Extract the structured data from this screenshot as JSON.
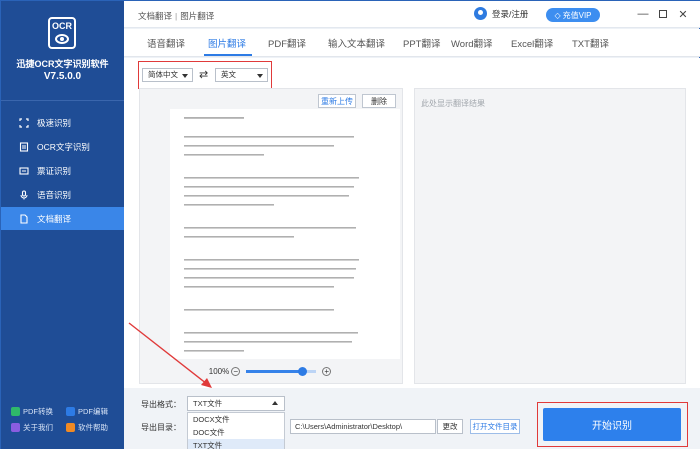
{
  "app": {
    "logo_text": "OCR",
    "name": "迅捷OCR文字识别软件",
    "version": "V7.5.0.0"
  },
  "sidebar": {
    "items": [
      {
        "label": "极速识别",
        "icon": "scan-icon",
        "active": false
      },
      {
        "label": "OCR文字识别",
        "icon": "ocr-icon",
        "active": false
      },
      {
        "label": "票证识别",
        "icon": "ticket-icon",
        "active": false
      },
      {
        "label": "语音识别",
        "icon": "microphone-icon",
        "active": false
      },
      {
        "label": "文档翻译",
        "icon": "document-icon",
        "active": true
      }
    ],
    "bottom_links": [
      {
        "label": "PDF转换",
        "color": "#2fb86a"
      },
      {
        "label": "PDF编辑",
        "color": "#2d7be5"
      },
      {
        "label": "关于我们",
        "color": "#8a5de0"
      },
      {
        "label": "软件帮助",
        "color": "#f08a24"
      }
    ]
  },
  "header": {
    "breadcrumb": [
      "文档翻译",
      "图片翻译"
    ],
    "login": "登录/注册",
    "vip": "充值VIP"
  },
  "tabs": [
    {
      "label": "语音翻译",
      "active": false
    },
    {
      "label": "图片翻译",
      "active": true
    },
    {
      "label": "PDF翻译",
      "active": false
    },
    {
      "label": "输入文本翻译",
      "active": false
    },
    {
      "label": "PPT翻译",
      "active": false
    },
    {
      "label": "Word翻译",
      "active": false
    },
    {
      "label": "Excel翻译",
      "active": false
    },
    {
      "label": "TXT翻译",
      "active": false
    }
  ],
  "translation": {
    "source_lang": "简体中文",
    "target_lang": "英文",
    "reupload": "重新上传",
    "delete": "删除",
    "zoom": "100%",
    "zoom_level": 0.8,
    "result_placeholder": "此处显示翻译结果"
  },
  "export": {
    "format_label": "导出格式：",
    "format_value": "TXT文件",
    "format_options": [
      "DOCX文件",
      "DOC文件",
      "TXT文件"
    ],
    "dir_label": "导出目录：",
    "dir_value": "C:\\Users\\Administrator\\Desktop\\",
    "change": "更改",
    "open_dir": "打开文件目录",
    "start": "开始识别"
  },
  "colors": {
    "sidebar": "#1f4d96",
    "accent": "#2d7be5",
    "highlight": "#e03a3a"
  }
}
